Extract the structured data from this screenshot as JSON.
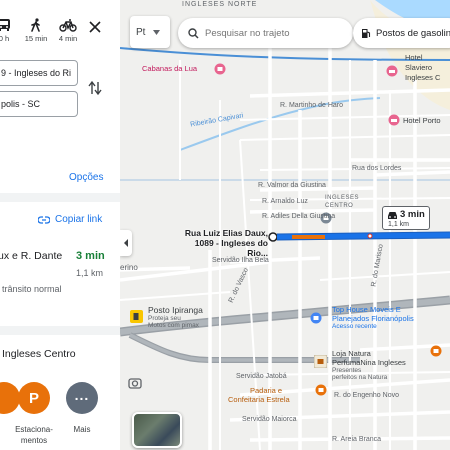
{
  "modes": [
    {
      "name": "transit",
      "time": "0 h"
    },
    {
      "name": "walk",
      "time": "15 min"
    },
    {
      "name": "bike",
      "time": "4 min"
    }
  ],
  "fields": {
    "origin": "9 - Ingleses do Ri",
    "destination": "polis - SC"
  },
  "options_label": "Opções",
  "copy_link_label": "Copiar link",
  "route": {
    "name": "ux e R. Dante",
    "time": "3 min",
    "distance": "1,1 km",
    "traffic": "trânsito normal"
  },
  "nearby": {
    "title": "Ingleses Centro",
    "items": [
      {
        "label": "Estaciona-\nmentos",
        "icon": "parking-icon",
        "color": "#e8710a"
      },
      {
        "label": "Mais",
        "icon": "more-icon",
        "color": "#5f6368"
      }
    ]
  },
  "map": {
    "lang_label": "Pt",
    "search_placeholder": "Pesquisar no trajeto",
    "gas_chip": "Postos de gasolina",
    "route_color": "#1a73e8",
    "start_label": "Rua Luiz Elias Daux, 1089 - Ingleses do Rio...",
    "bubble_time": "3 min",
    "bubble_dist": "1,1 km",
    "labels": {
      "top": "INGLESES NORTE",
      "cabanas": "Cabanas da Lua",
      "hotel_slaviero": "Hotel Slaviero Ingleses C",
      "hotel_porto": "Hotel Porto",
      "capivari": "Ribeirão Capivari",
      "martinho": "R. Martinho de Haro",
      "lordes": "Rua dos Lordes",
      "valmor": "R. Valmor da Giustina",
      "arnaldo": "R. Arnaldo Luz",
      "adiles": "R. Adiles Della Giustina",
      "ingleses_centro": "INGLESES CENTRO",
      "ilha_bela": "Servidão Ilha Bela",
      "vasco": "R. do Vasco",
      "marisco": "R. do Marisco",
      "posto": "Posto Ipiranga",
      "posto_sub1": "Proteja seu",
      "posto_sub2": "Motos com pimax",
      "tophouse": "Top House Moveis E",
      "tophouse2": "Planejados Florianópolis",
      "tophouse3": "Acesso recente",
      "loja": "Loja Natura",
      "loja2": "PerfumaNina Ingleses",
      "loja3": "Presentes",
      "loja4": "perfeitos na Natura",
      "jatoba": "Servidão Jatobá",
      "padaria": "Padaria e",
      "padaria2": "Confeitaria Estrela",
      "engenho": "R. do Engenho Novo",
      "maiorca": "Servidão Maiorca",
      "areia": "R. Areia Branca",
      "terino": "erino"
    }
  }
}
